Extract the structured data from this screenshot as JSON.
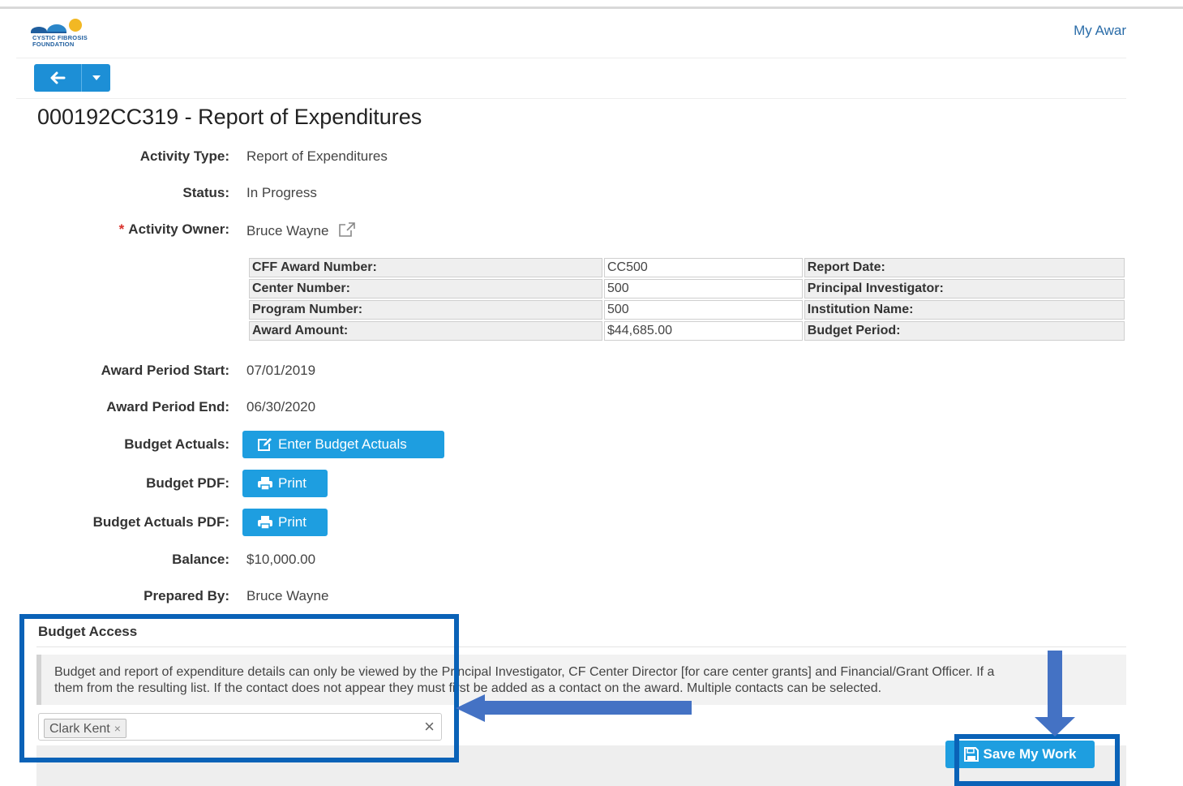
{
  "app": {
    "logo_text_line1": "CYSTIC FIBROSIS",
    "logo_text_line2": "FOUNDATION",
    "nav_link": "My Awar"
  },
  "page": {
    "title": "000192CC319 - Report of Expenditures"
  },
  "fields": {
    "activity_type": {
      "label": "Activity Type:",
      "value": "Report of Expenditures"
    },
    "status": {
      "label": "Status:",
      "value": "In Progress"
    },
    "activity_owner": {
      "required_mark": "*",
      "label": "Activity Owner:",
      "value": "Bruce Wayne",
      "link_icon": "external-link-icon"
    },
    "award_period_start": {
      "label": "Award Period Start:",
      "value": "07/01/2019"
    },
    "award_period_end": {
      "label": "Award Period End:",
      "value": "06/30/2020"
    },
    "budget_actuals": {
      "label": "Budget Actuals:",
      "button": "Enter Budget Actuals"
    },
    "budget_pdf": {
      "label": "Budget PDF:",
      "button": "Print"
    },
    "budget_actuals_pdf": {
      "label": "Budget Actuals PDF:",
      "button": "Print"
    },
    "balance": {
      "label": "Balance:",
      "value": "$10,000.00"
    },
    "prepared_by": {
      "label": "Prepared By:",
      "value": "Bruce Wayne"
    }
  },
  "award_table": {
    "rows": [
      {
        "key": "CFF Award Number:",
        "value": "CC500",
        "key2": "Report Date:"
      },
      {
        "key": "Center Number:",
        "value": "500",
        "key2": "Principal Investigator:"
      },
      {
        "key": "Program Number:",
        "value": "500",
        "key2": "Institution Name:"
      },
      {
        "key": "Award Amount:",
        "value": "$44,685.00",
        "key2": "Budget Period:"
      }
    ]
  },
  "budget_access": {
    "title": "Budget Access",
    "notice_line1": "Budget and report of expenditure details can only be viewed by the Principal Investigator, CF Center Director [for care center grants] and Financial/Grant Officer. If a",
    "notice_line2": "them from the resulting list. If the contact does not appear they must first be added as a contact on the award. Multiple contacts can be selected.",
    "selected_contacts": [
      "Clark Kent"
    ],
    "tag_remove": "×",
    "clear_all": "×"
  },
  "footer": {
    "save_button": "Save My Work"
  },
  "colors": {
    "primary": "#1e9ee0",
    "annotation": "#0a62b7",
    "arrow": "#4472c4"
  }
}
